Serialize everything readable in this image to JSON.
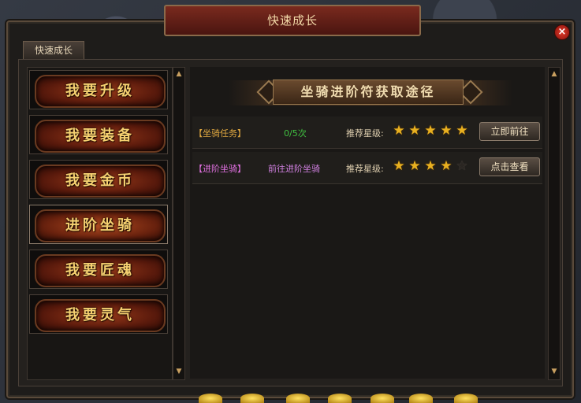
{
  "window": {
    "title": "快速成长",
    "close_label": "×"
  },
  "tabs": [
    {
      "label": "快速成长"
    }
  ],
  "menu": {
    "items": [
      {
        "label": "我要升级"
      },
      {
        "label": "我要装备"
      },
      {
        "label": "我要金币"
      },
      {
        "label": "进阶坐骑",
        "active": true
      },
      {
        "label": "我要匠魂"
      },
      {
        "label": "我要灵气"
      }
    ]
  },
  "scroll": {
    "up": "▲",
    "down": "▼"
  },
  "section": {
    "title": "坐骑进阶符获取途径"
  },
  "rows": [
    {
      "category": "【坐骑任务】",
      "category_color": "#e0a840",
      "info": "0/5次",
      "info_color": "#40c040",
      "rating_label": "推荐星级:",
      "stars": 5,
      "button": "立即前往"
    },
    {
      "category": "【进阶坐骑】",
      "category_color": "#e070e0",
      "info": "前往进阶坐骑",
      "info_color": "#d080e0",
      "rating_label": "推荐星级:",
      "stars": 4,
      "button": "点击查看"
    }
  ],
  "star_glyph": "★",
  "colors": {
    "accent": "#f5d070",
    "title_bar": "#7a2a1e"
  }
}
